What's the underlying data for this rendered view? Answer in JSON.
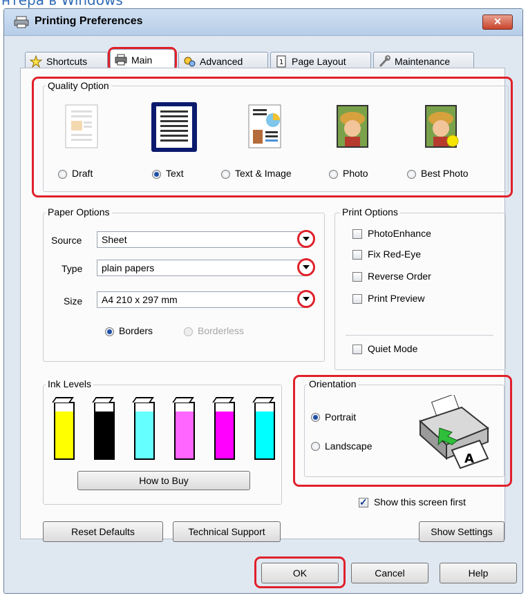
{
  "page": {
    "cut_title": "нтера в Windows"
  },
  "window": {
    "title": "Printing Preferences",
    "close_label": "✕"
  },
  "tabs": [
    {
      "label": "Shortcuts",
      "icon": "star-icon"
    },
    {
      "label": "Main",
      "icon": "printer-icon"
    },
    {
      "label": "Advanced",
      "icon": "gears-icon"
    },
    {
      "label": "Page Layout",
      "icon": "page-layout-icon"
    },
    {
      "label": "Maintenance",
      "icon": "wrench-icon"
    }
  ],
  "quality": {
    "legend": "Quality Option",
    "options": [
      {
        "label": "Draft",
        "selected": false
      },
      {
        "label": "Text",
        "selected": true
      },
      {
        "label": "Text & Image",
        "selected": false
      },
      {
        "label": "Photo",
        "selected": false
      },
      {
        "label": "Best Photo",
        "selected": false
      }
    ]
  },
  "paper": {
    "legend": "Paper Options",
    "source_label": "Source",
    "source_value": "Sheet",
    "type_label": "Type",
    "type_value": "plain papers",
    "size_label": "Size",
    "size_value": "A4 210 x 297 mm",
    "borders_label": "Borders",
    "borderless_label": "Borderless",
    "borders_selected": true
  },
  "print_options": {
    "legend": "Print Options",
    "photo_enhance": "PhotoEnhance",
    "fix_red_eye": "Fix Red-Eye",
    "reverse_order": "Reverse Order",
    "print_preview": "Print Preview",
    "quiet_mode": "Quiet Mode"
  },
  "ink": {
    "legend": "Ink Levels",
    "colors": [
      "#ffff00",
      "#000000",
      "#66ffff",
      "#ff66ff",
      "#ff00ff",
      "#00ffff"
    ],
    "levels": [
      0.85,
      0.85,
      0.85,
      0.85,
      0.85,
      0.85
    ],
    "how_to_buy": "How to Buy"
  },
  "orientation": {
    "legend": "Orientation",
    "portrait": "Portrait",
    "landscape": "Landscape",
    "portrait_selected": true
  },
  "show_first": {
    "label": "Show this screen first",
    "checked": true
  },
  "buttons": {
    "reset_defaults": "Reset Defaults",
    "technical_support": "Technical Support",
    "show_settings": "Show Settings",
    "ok": "OK",
    "cancel": "Cancel",
    "help": "Help"
  },
  "accent_colors": {
    "highlight": "#e0202a",
    "title_link": "#2f6bb5"
  }
}
